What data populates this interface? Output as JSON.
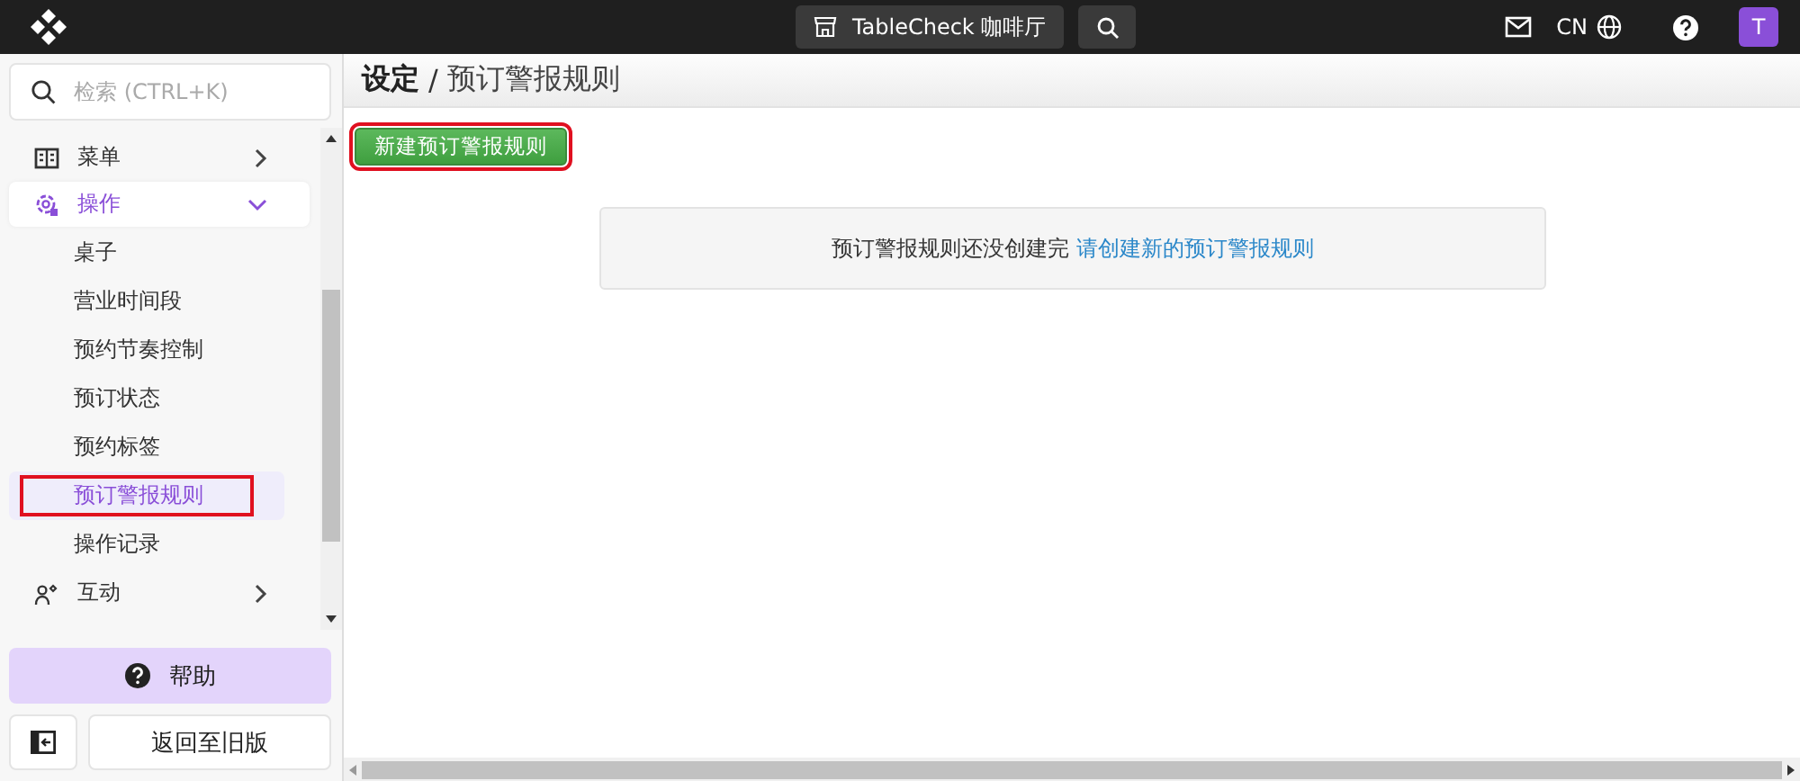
{
  "topbar": {
    "store": "TableCheck 咖啡厅",
    "language": "CN",
    "avatar": "T"
  },
  "sidebar": {
    "search": {
      "placeholder": "检索 (CTRL+K)"
    },
    "items": [
      {
        "label": "菜单",
        "expanded": false,
        "selected": false
      },
      {
        "label": "操作",
        "expanded": true,
        "selected": true,
        "children": [
          {
            "label": "桌子",
            "selected": false,
            "highlighted": false
          },
          {
            "label": "营业时间段",
            "selected": false,
            "highlighted": false
          },
          {
            "label": "预约节奏控制",
            "selected": false,
            "highlighted": false
          },
          {
            "label": "预订状态",
            "selected": false,
            "highlighted": false
          },
          {
            "label": "预约标签",
            "selected": false,
            "highlighted": false
          },
          {
            "label": "预订警报规则",
            "selected": true,
            "highlighted": true
          },
          {
            "label": "操作记录",
            "selected": false,
            "highlighted": false
          }
        ]
      },
      {
        "label": "互动",
        "expanded": false,
        "selected": false
      }
    ],
    "help": "帮助",
    "back": "返回至旧版"
  },
  "breadcrumb": {
    "section": "设定",
    "separator": "/",
    "page": "预订警报规则"
  },
  "new_button": {
    "label": "新建预订警报规则",
    "highlighted": true
  },
  "empty_state": {
    "message": "预订警报规则还没创建完",
    "link": "请创建新的预订警报规则"
  }
}
